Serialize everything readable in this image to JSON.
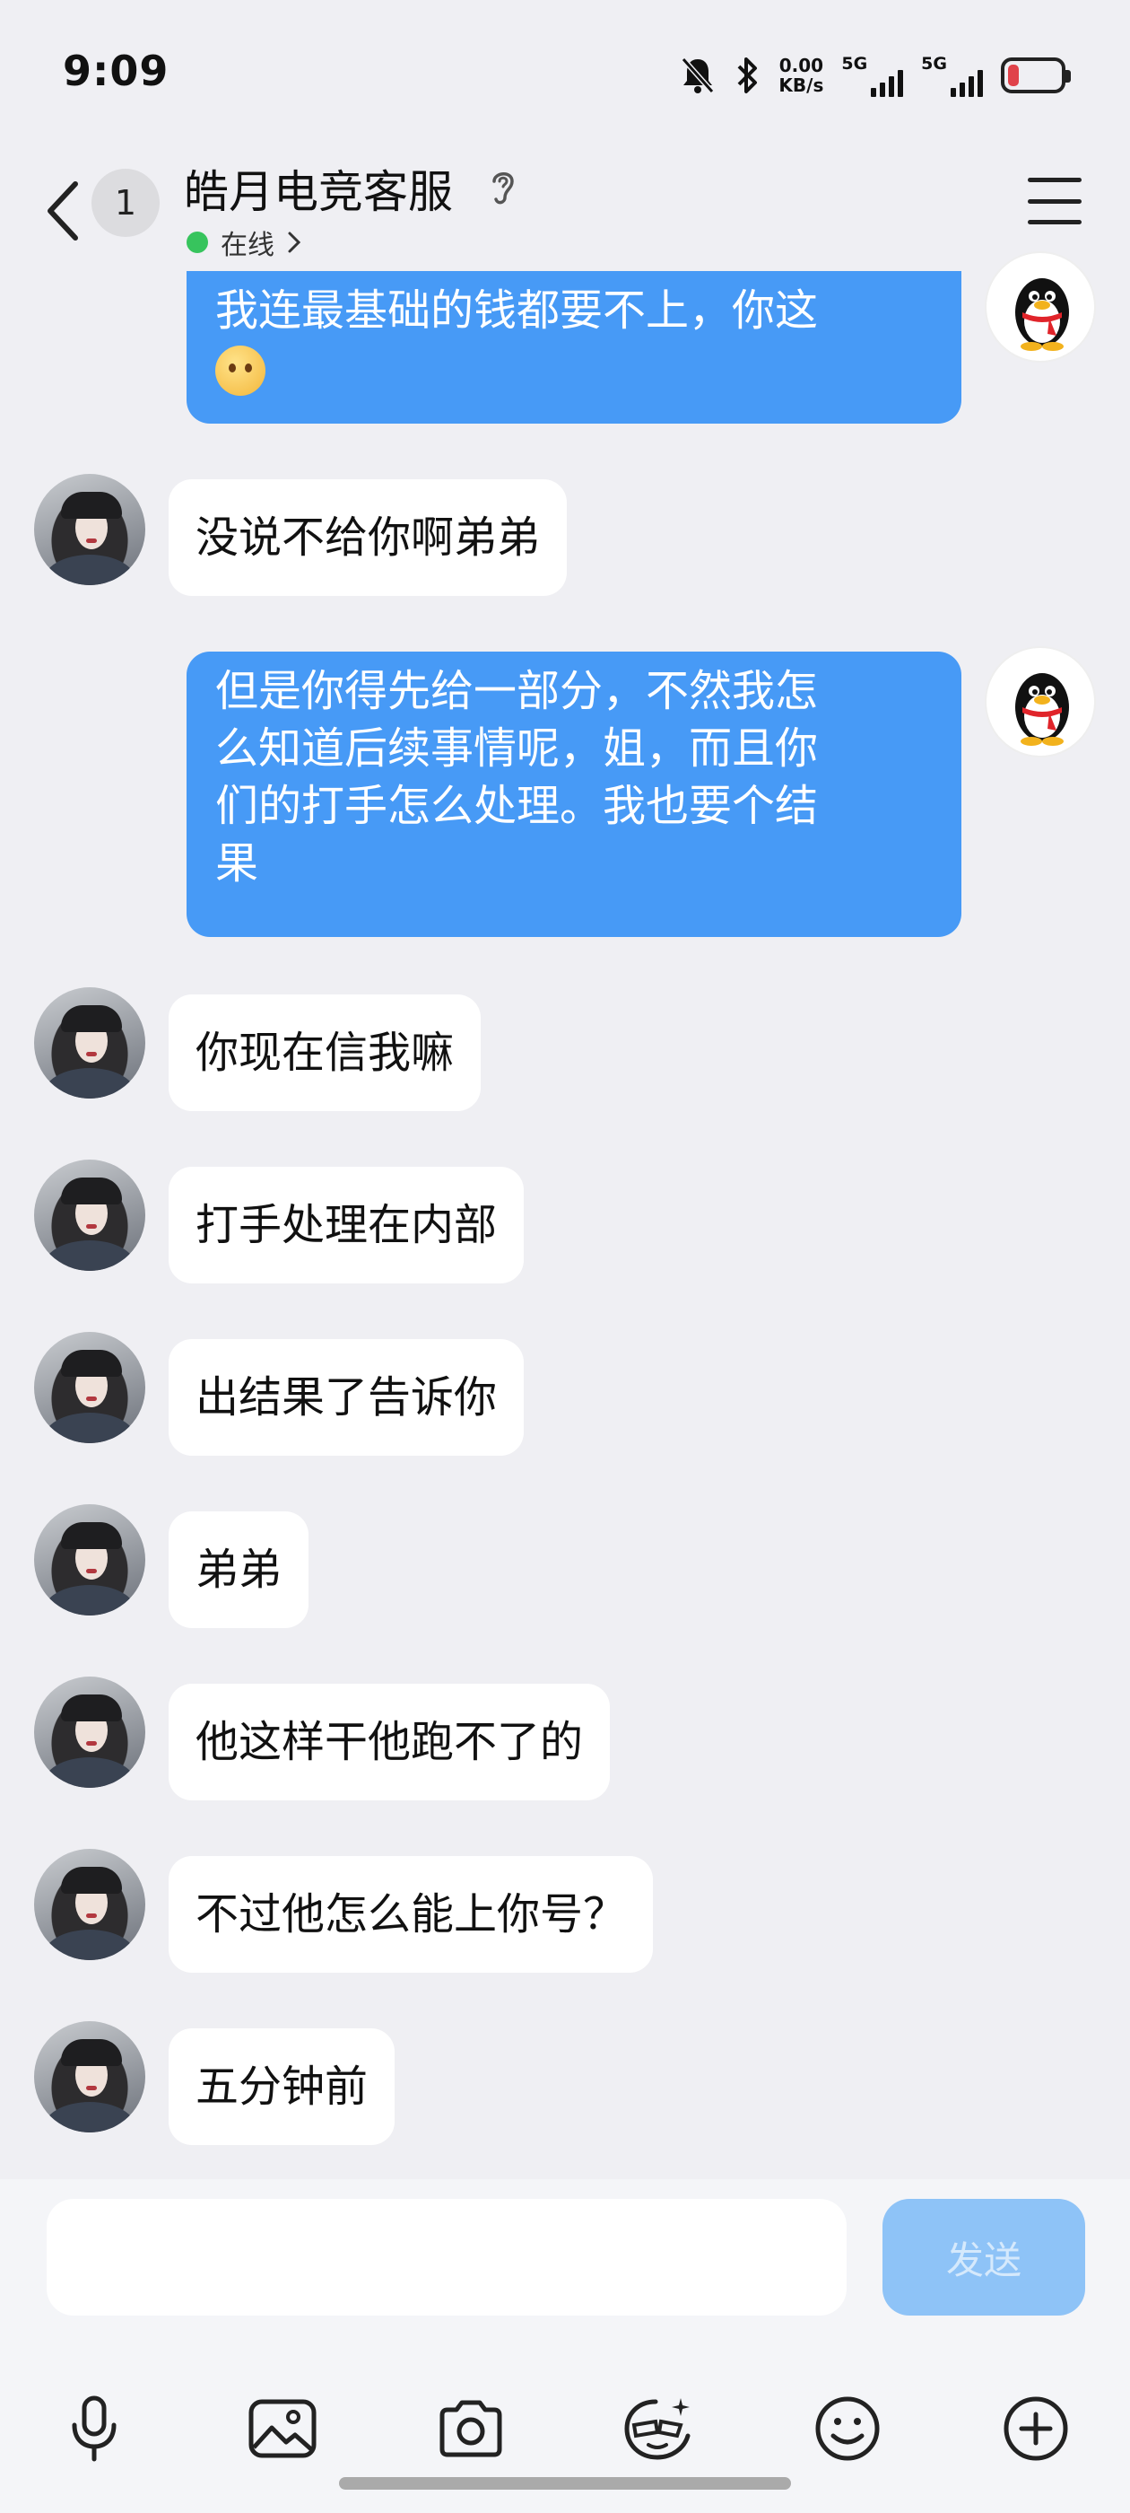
{
  "status_bar": {
    "time": "9:09",
    "speed_value": "0.00",
    "speed_unit": "KB/s",
    "net1": "5G",
    "net2": "5G"
  },
  "header": {
    "unread_count": "1",
    "title": "皓月电竞客服",
    "status": "在线"
  },
  "messages": [
    {
      "side": "out",
      "text": "我连最基础的钱都要不上，你这",
      "emoji": "face-emoji"
    },
    {
      "side": "in",
      "text": "没说不给你啊弟弟"
    },
    {
      "side": "out",
      "lines": [
        "但是你得先给一部分，不然我怎",
        "么知道后续事情呢，姐，而且你",
        "们的打手怎么处理。我也要个结",
        "果"
      ]
    },
    {
      "side": "in",
      "text": "你现在信我嘛"
    },
    {
      "side": "in",
      "text": "打手处理在内部"
    },
    {
      "side": "in",
      "text": "出结果了告诉你"
    },
    {
      "side": "in",
      "text": "弟弟"
    },
    {
      "side": "in",
      "text": "他这样干他跑不了的"
    },
    {
      "side": "in",
      "text": "不过他怎么能上你号？"
    },
    {
      "side": "in",
      "text": "五分钟前"
    }
  ],
  "input": {
    "placeholder": "",
    "send_label": "发送"
  },
  "toolbar_icons": [
    "microphone-icon",
    "image-icon",
    "camera-icon",
    "sticker-icon",
    "emoji-icon",
    "plus-icon"
  ],
  "colors": {
    "background": "#efeff3",
    "outgoing_bubble": "#479af6",
    "incoming_bubble": "#ffffff",
    "send_button": "#8ec3f7",
    "online_dot": "#37c45d"
  }
}
